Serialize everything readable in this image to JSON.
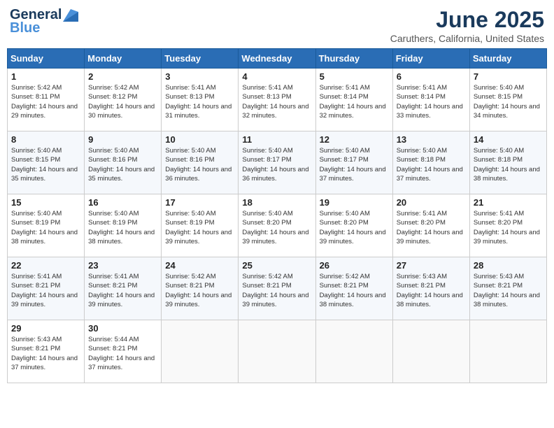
{
  "header": {
    "logo_line1": "General",
    "logo_line2": "Blue",
    "month": "June 2025",
    "location": "Caruthers, California, United States"
  },
  "weekdays": [
    "Sunday",
    "Monday",
    "Tuesday",
    "Wednesday",
    "Thursday",
    "Friday",
    "Saturday"
  ],
  "weeks": [
    [
      {
        "day": "1",
        "sunrise": "5:42 AM",
        "sunset": "8:11 PM",
        "daylight": "14 hours and 29 minutes."
      },
      {
        "day": "2",
        "sunrise": "5:42 AM",
        "sunset": "8:12 PM",
        "daylight": "14 hours and 30 minutes."
      },
      {
        "day": "3",
        "sunrise": "5:41 AM",
        "sunset": "8:13 PM",
        "daylight": "14 hours and 31 minutes."
      },
      {
        "day": "4",
        "sunrise": "5:41 AM",
        "sunset": "8:13 PM",
        "daylight": "14 hours and 32 minutes."
      },
      {
        "day": "5",
        "sunrise": "5:41 AM",
        "sunset": "8:14 PM",
        "daylight": "14 hours and 32 minutes."
      },
      {
        "day": "6",
        "sunrise": "5:41 AM",
        "sunset": "8:14 PM",
        "daylight": "14 hours and 33 minutes."
      },
      {
        "day": "7",
        "sunrise": "5:40 AM",
        "sunset": "8:15 PM",
        "daylight": "14 hours and 34 minutes."
      }
    ],
    [
      {
        "day": "8",
        "sunrise": "5:40 AM",
        "sunset": "8:15 PM",
        "daylight": "14 hours and 35 minutes."
      },
      {
        "day": "9",
        "sunrise": "5:40 AM",
        "sunset": "8:16 PM",
        "daylight": "14 hours and 35 minutes."
      },
      {
        "day": "10",
        "sunrise": "5:40 AM",
        "sunset": "8:16 PM",
        "daylight": "14 hours and 36 minutes."
      },
      {
        "day": "11",
        "sunrise": "5:40 AM",
        "sunset": "8:17 PM",
        "daylight": "14 hours and 36 minutes."
      },
      {
        "day": "12",
        "sunrise": "5:40 AM",
        "sunset": "8:17 PM",
        "daylight": "14 hours and 37 minutes."
      },
      {
        "day": "13",
        "sunrise": "5:40 AM",
        "sunset": "8:18 PM",
        "daylight": "14 hours and 37 minutes."
      },
      {
        "day": "14",
        "sunrise": "5:40 AM",
        "sunset": "8:18 PM",
        "daylight": "14 hours and 38 minutes."
      }
    ],
    [
      {
        "day": "15",
        "sunrise": "5:40 AM",
        "sunset": "8:19 PM",
        "daylight": "14 hours and 38 minutes."
      },
      {
        "day": "16",
        "sunrise": "5:40 AM",
        "sunset": "8:19 PM",
        "daylight": "14 hours and 38 minutes."
      },
      {
        "day": "17",
        "sunrise": "5:40 AM",
        "sunset": "8:19 PM",
        "daylight": "14 hours and 39 minutes."
      },
      {
        "day": "18",
        "sunrise": "5:40 AM",
        "sunset": "8:20 PM",
        "daylight": "14 hours and 39 minutes."
      },
      {
        "day": "19",
        "sunrise": "5:40 AM",
        "sunset": "8:20 PM",
        "daylight": "14 hours and 39 minutes."
      },
      {
        "day": "20",
        "sunrise": "5:41 AM",
        "sunset": "8:20 PM",
        "daylight": "14 hours and 39 minutes."
      },
      {
        "day": "21",
        "sunrise": "5:41 AM",
        "sunset": "8:20 PM",
        "daylight": "14 hours and 39 minutes."
      }
    ],
    [
      {
        "day": "22",
        "sunrise": "5:41 AM",
        "sunset": "8:21 PM",
        "daylight": "14 hours and 39 minutes."
      },
      {
        "day": "23",
        "sunrise": "5:41 AM",
        "sunset": "8:21 PM",
        "daylight": "14 hours and 39 minutes."
      },
      {
        "day": "24",
        "sunrise": "5:42 AM",
        "sunset": "8:21 PM",
        "daylight": "14 hours and 39 minutes."
      },
      {
        "day": "25",
        "sunrise": "5:42 AM",
        "sunset": "8:21 PM",
        "daylight": "14 hours and 39 minutes."
      },
      {
        "day": "26",
        "sunrise": "5:42 AM",
        "sunset": "8:21 PM",
        "daylight": "14 hours and 38 minutes."
      },
      {
        "day": "27",
        "sunrise": "5:43 AM",
        "sunset": "8:21 PM",
        "daylight": "14 hours and 38 minutes."
      },
      {
        "day": "28",
        "sunrise": "5:43 AM",
        "sunset": "8:21 PM",
        "daylight": "14 hours and 38 minutes."
      }
    ],
    [
      {
        "day": "29",
        "sunrise": "5:43 AM",
        "sunset": "8:21 PM",
        "daylight": "14 hours and 37 minutes."
      },
      {
        "day": "30",
        "sunrise": "5:44 AM",
        "sunset": "8:21 PM",
        "daylight": "14 hours and 37 minutes."
      },
      null,
      null,
      null,
      null,
      null
    ]
  ],
  "labels": {
    "sunrise": "Sunrise:",
    "sunset": "Sunset:",
    "daylight": "Daylight:"
  }
}
